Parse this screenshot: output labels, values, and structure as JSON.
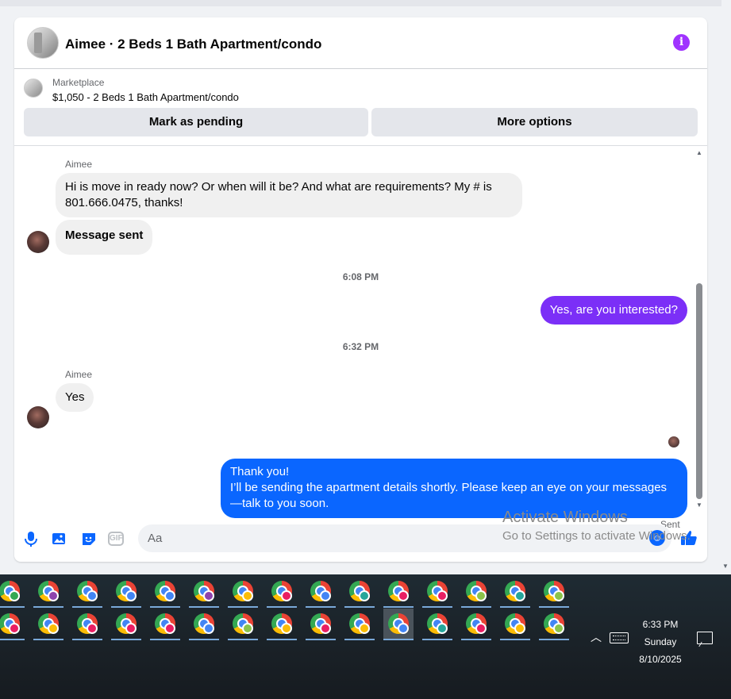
{
  "conversation": {
    "title": "Aimee · 2 Beds 1 Bath Apartment/condo"
  },
  "listing": {
    "source": "Marketplace",
    "title": "$1,050 - 2 Beds 1 Bath Apartment/condo",
    "buttons": {
      "pending": "Mark as pending",
      "more": "More options"
    }
  },
  "messages": {
    "sender_name": "Aimee",
    "m1": "Hi is move in ready now? Or when will it be? And what are requirements? My # is 801.666.0475, thanks!",
    "m2": "Message sent",
    "time1": "6:08 PM",
    "m3": "Yes, are you interested?",
    "time2": "6:32 PM",
    "m4": "Yes",
    "m5_line1": "Thank you!",
    "m5_line2": "I’ll be sending the apartment details shortly. Please keep an eye on your messages—talk to you soon.",
    "status": "Sent"
  },
  "composer": {
    "placeholder": "Aa",
    "gif_label": "GIF"
  },
  "watermark": {
    "title": "Activate Windows",
    "subtitle": "Go to Settings to activate Windows."
  },
  "taskbar": {
    "time": "6:33 PM",
    "day": "Sunday",
    "date": "8/10/2025",
    "badge_colors_row1": [
      "#34a853",
      "#8e44ad",
      "#4285f4",
      "#4285f4",
      "#4285f4",
      "#8e44ad",
      "#fbbc05",
      "#e91e63",
      "#4285f4",
      "#26a69a",
      "#e91e63",
      "#e91e63",
      "#8bc34a",
      "#26a69a",
      "#8bc34a"
    ],
    "badge_colors_row2": [
      "#e91e63",
      "#fbbc05",
      "#e91e63",
      "#e91e63",
      "#e91e63",
      "#4285f4",
      "#8bc34a",
      "#fbbc05",
      "#e91e63",
      "#fbbc05",
      "#4285f4",
      "#26a69a",
      "#e91e63",
      "#fbbc05",
      "#8bc34a"
    ]
  },
  "colors": {
    "info": "#a033ff",
    "outgoing_purple": "#7b2ff7",
    "outgoing_blue": "#0a66ff",
    "accent": "#0a66ff"
  }
}
